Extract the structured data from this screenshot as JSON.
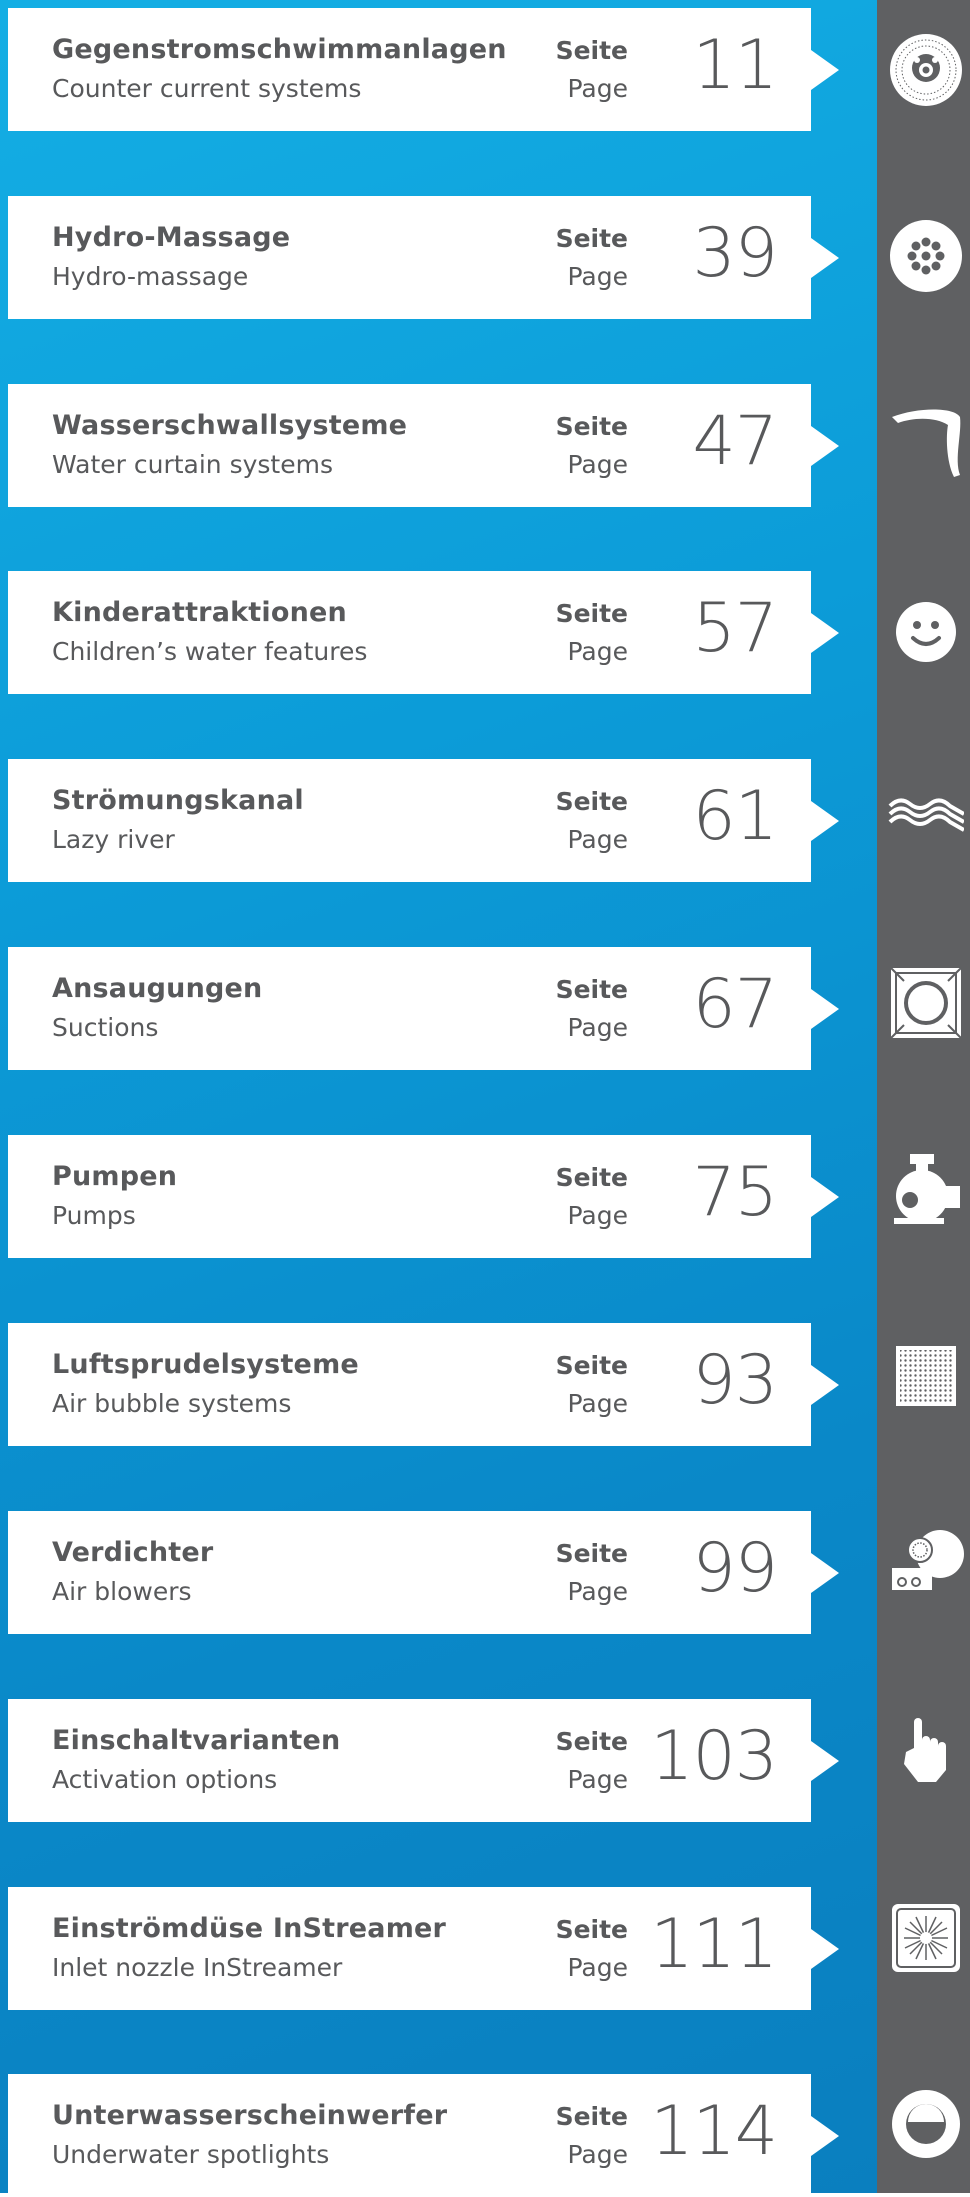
{
  "colors": {
    "accent": "#0a9ad6",
    "sidebar": "#5f6062",
    "text": "#58595b"
  },
  "entries": [
    {
      "title": "Gegenstromschwimmanlagen",
      "subtitle": "Counter current systems",
      "seite": "Seite",
      "page": "Page",
      "number": "11",
      "icon": "counter-current-jet-icon"
    },
    {
      "title": "Hydro-Massage",
      "subtitle": "Hydro-massage",
      "seite": "Seite",
      "page": "Page",
      "number": "39",
      "icon": "massage-nozzle-icon"
    },
    {
      "title": "Wasserschwallsysteme",
      "subtitle": "Water curtain systems",
      "seite": "Seite",
      "page": "Page",
      "number": "47",
      "icon": "water-curtain-icon"
    },
    {
      "title": "Kinderattraktionen",
      "subtitle": "Children’s water features",
      "seite": "Seite",
      "page": "Page",
      "number": "57",
      "icon": "smiley-icon"
    },
    {
      "title": "Strömungskanal",
      "subtitle": "Lazy river",
      "seite": "Seite",
      "page": "Page",
      "number": "61",
      "icon": "water-waves-icon"
    },
    {
      "title": "Ansaugungen",
      "subtitle": "Suctions",
      "seite": "Seite",
      "page": "Page",
      "number": "67",
      "icon": "suction-grate-icon"
    },
    {
      "title": "Pumpen",
      "subtitle": "Pumps",
      "seite": "Seite",
      "page": "Page",
      "number": "75",
      "icon": "pump-icon"
    },
    {
      "title": "Luftsprudelsysteme",
      "subtitle": "Air bubble systems",
      "seite": "Seite",
      "page": "Page",
      "number": "93",
      "icon": "bubble-grid-icon"
    },
    {
      "title": "Verdichter",
      "subtitle": "Air blowers",
      "seite": "Seite",
      "page": "Page",
      "number": "99",
      "icon": "blower-icon"
    },
    {
      "title": "Einschaltvarianten",
      "subtitle": "Activation options",
      "seite": "Seite",
      "page": "Page",
      "number": "103",
      "icon": "hand-pointer-icon"
    },
    {
      "title": "Einströmdüse InStreamer",
      "subtitle": "Inlet nozzle InStreamer",
      "seite": "Seite",
      "page": "Page",
      "number": "111",
      "icon": "inlet-nozzle-icon"
    },
    {
      "title": "Unterwasserscheinwerfer",
      "subtitle": "Underwater spotlights",
      "seite": "Seite",
      "page": "Page",
      "number": "114",
      "icon": "spotlight-icon"
    }
  ]
}
